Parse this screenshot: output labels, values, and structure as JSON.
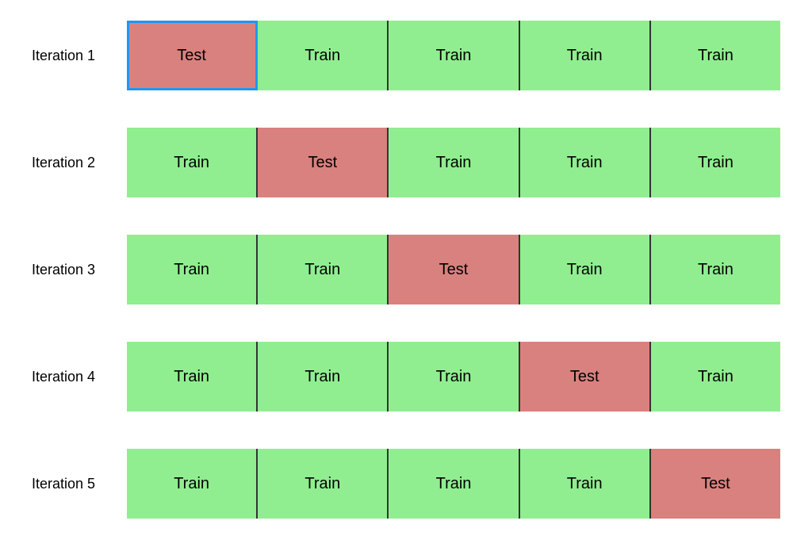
{
  "iterations": [
    {
      "label": "Iteration 1",
      "folds": [
        {
          "type": "test",
          "text": "Test",
          "highlighted": true
        },
        {
          "type": "train",
          "text": "Train"
        },
        {
          "type": "train",
          "text": "Train"
        },
        {
          "type": "train",
          "text": "Train"
        },
        {
          "type": "train",
          "text": "Train"
        }
      ]
    },
    {
      "label": "Iteration 2",
      "folds": [
        {
          "type": "train",
          "text": "Train"
        },
        {
          "type": "test",
          "text": "Test",
          "highlighted": false
        },
        {
          "type": "train",
          "text": "Train"
        },
        {
          "type": "train",
          "text": "Train"
        },
        {
          "type": "train",
          "text": "Train"
        }
      ]
    },
    {
      "label": "Iteration 3",
      "folds": [
        {
          "type": "train",
          "text": "Train"
        },
        {
          "type": "train",
          "text": "Train"
        },
        {
          "type": "test",
          "text": "Test",
          "highlighted": false
        },
        {
          "type": "train",
          "text": "Train"
        },
        {
          "type": "train",
          "text": "Train"
        }
      ]
    },
    {
      "label": "Iteration 4",
      "folds": [
        {
          "type": "train",
          "text": "Train"
        },
        {
          "type": "train",
          "text": "Train"
        },
        {
          "type": "train",
          "text": "Train"
        },
        {
          "type": "test",
          "text": "Test",
          "highlighted": false
        },
        {
          "type": "train",
          "text": "Train"
        }
      ]
    },
    {
      "label": "Iteration 5",
      "folds": [
        {
          "type": "train",
          "text": "Train"
        },
        {
          "type": "train",
          "text": "Train"
        },
        {
          "type": "train",
          "text": "Train"
        },
        {
          "type": "train",
          "text": "Train"
        },
        {
          "type": "test",
          "text": "Test",
          "highlighted": false
        }
      ]
    }
  ]
}
